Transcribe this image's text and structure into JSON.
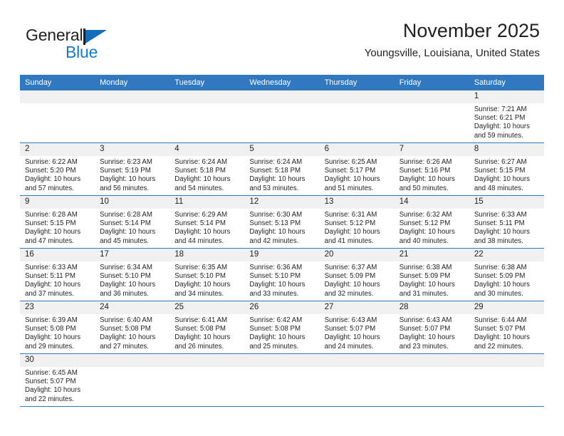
{
  "logo": {
    "word1": "General",
    "word2": "Blue",
    "triangle_color": "#136dbd",
    "blue_text_color": "#1579c6"
  },
  "header": {
    "month_title": "November 2025",
    "location": "Youngsville, Louisiana, United States"
  },
  "theme": {
    "header_bg": "#3178be",
    "header_text": "#ffffff",
    "daynum_bg": "#f0f0f0",
    "row_border": "#3178be",
    "body_text": "#231f20"
  },
  "weekdays": [
    "Sunday",
    "Monday",
    "Tuesday",
    "Wednesday",
    "Thursday",
    "Friday",
    "Saturday"
  ],
  "weeks": [
    [
      {
        "day": "",
        "blank": true,
        "sunrise": "",
        "sunset": "",
        "daylight_line1": "",
        "daylight_line2": ""
      },
      {
        "day": "",
        "blank": true,
        "sunrise": "",
        "sunset": "",
        "daylight_line1": "",
        "daylight_line2": ""
      },
      {
        "day": "",
        "blank": true,
        "sunrise": "",
        "sunset": "",
        "daylight_line1": "",
        "daylight_line2": ""
      },
      {
        "day": "",
        "blank": true,
        "sunrise": "",
        "sunset": "",
        "daylight_line1": "",
        "daylight_line2": ""
      },
      {
        "day": "",
        "blank": true,
        "sunrise": "",
        "sunset": "",
        "daylight_line1": "",
        "daylight_line2": ""
      },
      {
        "day": "",
        "blank": true,
        "sunrise": "",
        "sunset": "",
        "daylight_line1": "",
        "daylight_line2": ""
      },
      {
        "day": "1",
        "blank": false,
        "sunrise": "Sunrise: 7:21 AM",
        "sunset": "Sunset: 6:21 PM",
        "daylight_line1": "Daylight: 10 hours",
        "daylight_line2": "and 59 minutes."
      }
    ],
    [
      {
        "day": "2",
        "blank": false,
        "sunrise": "Sunrise: 6:22 AM",
        "sunset": "Sunset: 5:20 PM",
        "daylight_line1": "Daylight: 10 hours",
        "daylight_line2": "and 57 minutes."
      },
      {
        "day": "3",
        "blank": false,
        "sunrise": "Sunrise: 6:23 AM",
        "sunset": "Sunset: 5:19 PM",
        "daylight_line1": "Daylight: 10 hours",
        "daylight_line2": "and 56 minutes."
      },
      {
        "day": "4",
        "blank": false,
        "sunrise": "Sunrise: 6:24 AM",
        "sunset": "Sunset: 5:18 PM",
        "daylight_line1": "Daylight: 10 hours",
        "daylight_line2": "and 54 minutes."
      },
      {
        "day": "5",
        "blank": false,
        "sunrise": "Sunrise: 6:24 AM",
        "sunset": "Sunset: 5:18 PM",
        "daylight_line1": "Daylight: 10 hours",
        "daylight_line2": "and 53 minutes."
      },
      {
        "day": "6",
        "blank": false,
        "sunrise": "Sunrise: 6:25 AM",
        "sunset": "Sunset: 5:17 PM",
        "daylight_line1": "Daylight: 10 hours",
        "daylight_line2": "and 51 minutes."
      },
      {
        "day": "7",
        "blank": false,
        "sunrise": "Sunrise: 6:26 AM",
        "sunset": "Sunset: 5:16 PM",
        "daylight_line1": "Daylight: 10 hours",
        "daylight_line2": "and 50 minutes."
      },
      {
        "day": "8",
        "blank": false,
        "sunrise": "Sunrise: 6:27 AM",
        "sunset": "Sunset: 5:15 PM",
        "daylight_line1": "Daylight: 10 hours",
        "daylight_line2": "and 48 minutes."
      }
    ],
    [
      {
        "day": "9",
        "blank": false,
        "sunrise": "Sunrise: 6:28 AM",
        "sunset": "Sunset: 5:15 PM",
        "daylight_line1": "Daylight: 10 hours",
        "daylight_line2": "and 47 minutes."
      },
      {
        "day": "10",
        "blank": false,
        "sunrise": "Sunrise: 6:28 AM",
        "sunset": "Sunset: 5:14 PM",
        "daylight_line1": "Daylight: 10 hours",
        "daylight_line2": "and 45 minutes."
      },
      {
        "day": "11",
        "blank": false,
        "sunrise": "Sunrise: 6:29 AM",
        "sunset": "Sunset: 5:14 PM",
        "daylight_line1": "Daylight: 10 hours",
        "daylight_line2": "and 44 minutes."
      },
      {
        "day": "12",
        "blank": false,
        "sunrise": "Sunrise: 6:30 AM",
        "sunset": "Sunset: 5:13 PM",
        "daylight_line1": "Daylight: 10 hours",
        "daylight_line2": "and 42 minutes."
      },
      {
        "day": "13",
        "blank": false,
        "sunrise": "Sunrise: 6:31 AM",
        "sunset": "Sunset: 5:12 PM",
        "daylight_line1": "Daylight: 10 hours",
        "daylight_line2": "and 41 minutes."
      },
      {
        "day": "14",
        "blank": false,
        "sunrise": "Sunrise: 6:32 AM",
        "sunset": "Sunset: 5:12 PM",
        "daylight_line1": "Daylight: 10 hours",
        "daylight_line2": "and 40 minutes."
      },
      {
        "day": "15",
        "blank": false,
        "sunrise": "Sunrise: 6:33 AM",
        "sunset": "Sunset: 5:11 PM",
        "daylight_line1": "Daylight: 10 hours",
        "daylight_line2": "and 38 minutes."
      }
    ],
    [
      {
        "day": "16",
        "blank": false,
        "sunrise": "Sunrise: 6:33 AM",
        "sunset": "Sunset: 5:11 PM",
        "daylight_line1": "Daylight: 10 hours",
        "daylight_line2": "and 37 minutes."
      },
      {
        "day": "17",
        "blank": false,
        "sunrise": "Sunrise: 6:34 AM",
        "sunset": "Sunset: 5:10 PM",
        "daylight_line1": "Daylight: 10 hours",
        "daylight_line2": "and 36 minutes."
      },
      {
        "day": "18",
        "blank": false,
        "sunrise": "Sunrise: 6:35 AM",
        "sunset": "Sunset: 5:10 PM",
        "daylight_line1": "Daylight: 10 hours",
        "daylight_line2": "and 34 minutes."
      },
      {
        "day": "19",
        "blank": false,
        "sunrise": "Sunrise: 6:36 AM",
        "sunset": "Sunset: 5:10 PM",
        "daylight_line1": "Daylight: 10 hours",
        "daylight_line2": "and 33 minutes."
      },
      {
        "day": "20",
        "blank": false,
        "sunrise": "Sunrise: 6:37 AM",
        "sunset": "Sunset: 5:09 PM",
        "daylight_line1": "Daylight: 10 hours",
        "daylight_line2": "and 32 minutes."
      },
      {
        "day": "21",
        "blank": false,
        "sunrise": "Sunrise: 6:38 AM",
        "sunset": "Sunset: 5:09 PM",
        "daylight_line1": "Daylight: 10 hours",
        "daylight_line2": "and 31 minutes."
      },
      {
        "day": "22",
        "blank": false,
        "sunrise": "Sunrise: 6:38 AM",
        "sunset": "Sunset: 5:09 PM",
        "daylight_line1": "Daylight: 10 hours",
        "daylight_line2": "and 30 minutes."
      }
    ],
    [
      {
        "day": "23",
        "blank": false,
        "sunrise": "Sunrise: 6:39 AM",
        "sunset": "Sunset: 5:08 PM",
        "daylight_line1": "Daylight: 10 hours",
        "daylight_line2": "and 29 minutes."
      },
      {
        "day": "24",
        "blank": false,
        "sunrise": "Sunrise: 6:40 AM",
        "sunset": "Sunset: 5:08 PM",
        "daylight_line1": "Daylight: 10 hours",
        "daylight_line2": "and 27 minutes."
      },
      {
        "day": "25",
        "blank": false,
        "sunrise": "Sunrise: 6:41 AM",
        "sunset": "Sunset: 5:08 PM",
        "daylight_line1": "Daylight: 10 hours",
        "daylight_line2": "and 26 minutes."
      },
      {
        "day": "26",
        "blank": false,
        "sunrise": "Sunrise: 6:42 AM",
        "sunset": "Sunset: 5:08 PM",
        "daylight_line1": "Daylight: 10 hours",
        "daylight_line2": "and 25 minutes."
      },
      {
        "day": "27",
        "blank": false,
        "sunrise": "Sunrise: 6:43 AM",
        "sunset": "Sunset: 5:07 PM",
        "daylight_line1": "Daylight: 10 hours",
        "daylight_line2": "and 24 minutes."
      },
      {
        "day": "28",
        "blank": false,
        "sunrise": "Sunrise: 6:43 AM",
        "sunset": "Sunset: 5:07 PM",
        "daylight_line1": "Daylight: 10 hours",
        "daylight_line2": "and 23 minutes."
      },
      {
        "day": "29",
        "blank": false,
        "sunrise": "Sunrise: 6:44 AM",
        "sunset": "Sunset: 5:07 PM",
        "daylight_line1": "Daylight: 10 hours",
        "daylight_line2": "and 22 minutes."
      }
    ],
    [
      {
        "day": "30",
        "blank": false,
        "sunrise": "Sunrise: 6:45 AM",
        "sunset": "Sunset: 5:07 PM",
        "daylight_line1": "Daylight: 10 hours",
        "daylight_line2": "and 22 minutes."
      },
      {
        "day": "",
        "blank": true,
        "sunrise": "",
        "sunset": "",
        "daylight_line1": "",
        "daylight_line2": ""
      },
      {
        "day": "",
        "blank": true,
        "sunrise": "",
        "sunset": "",
        "daylight_line1": "",
        "daylight_line2": ""
      },
      {
        "day": "",
        "blank": true,
        "sunrise": "",
        "sunset": "",
        "daylight_line1": "",
        "daylight_line2": ""
      },
      {
        "day": "",
        "blank": true,
        "sunrise": "",
        "sunset": "",
        "daylight_line1": "",
        "daylight_line2": ""
      },
      {
        "day": "",
        "blank": true,
        "sunrise": "",
        "sunset": "",
        "daylight_line1": "",
        "daylight_line2": ""
      },
      {
        "day": "",
        "blank": true,
        "sunrise": "",
        "sunset": "",
        "daylight_line1": "",
        "daylight_line2": ""
      }
    ]
  ]
}
